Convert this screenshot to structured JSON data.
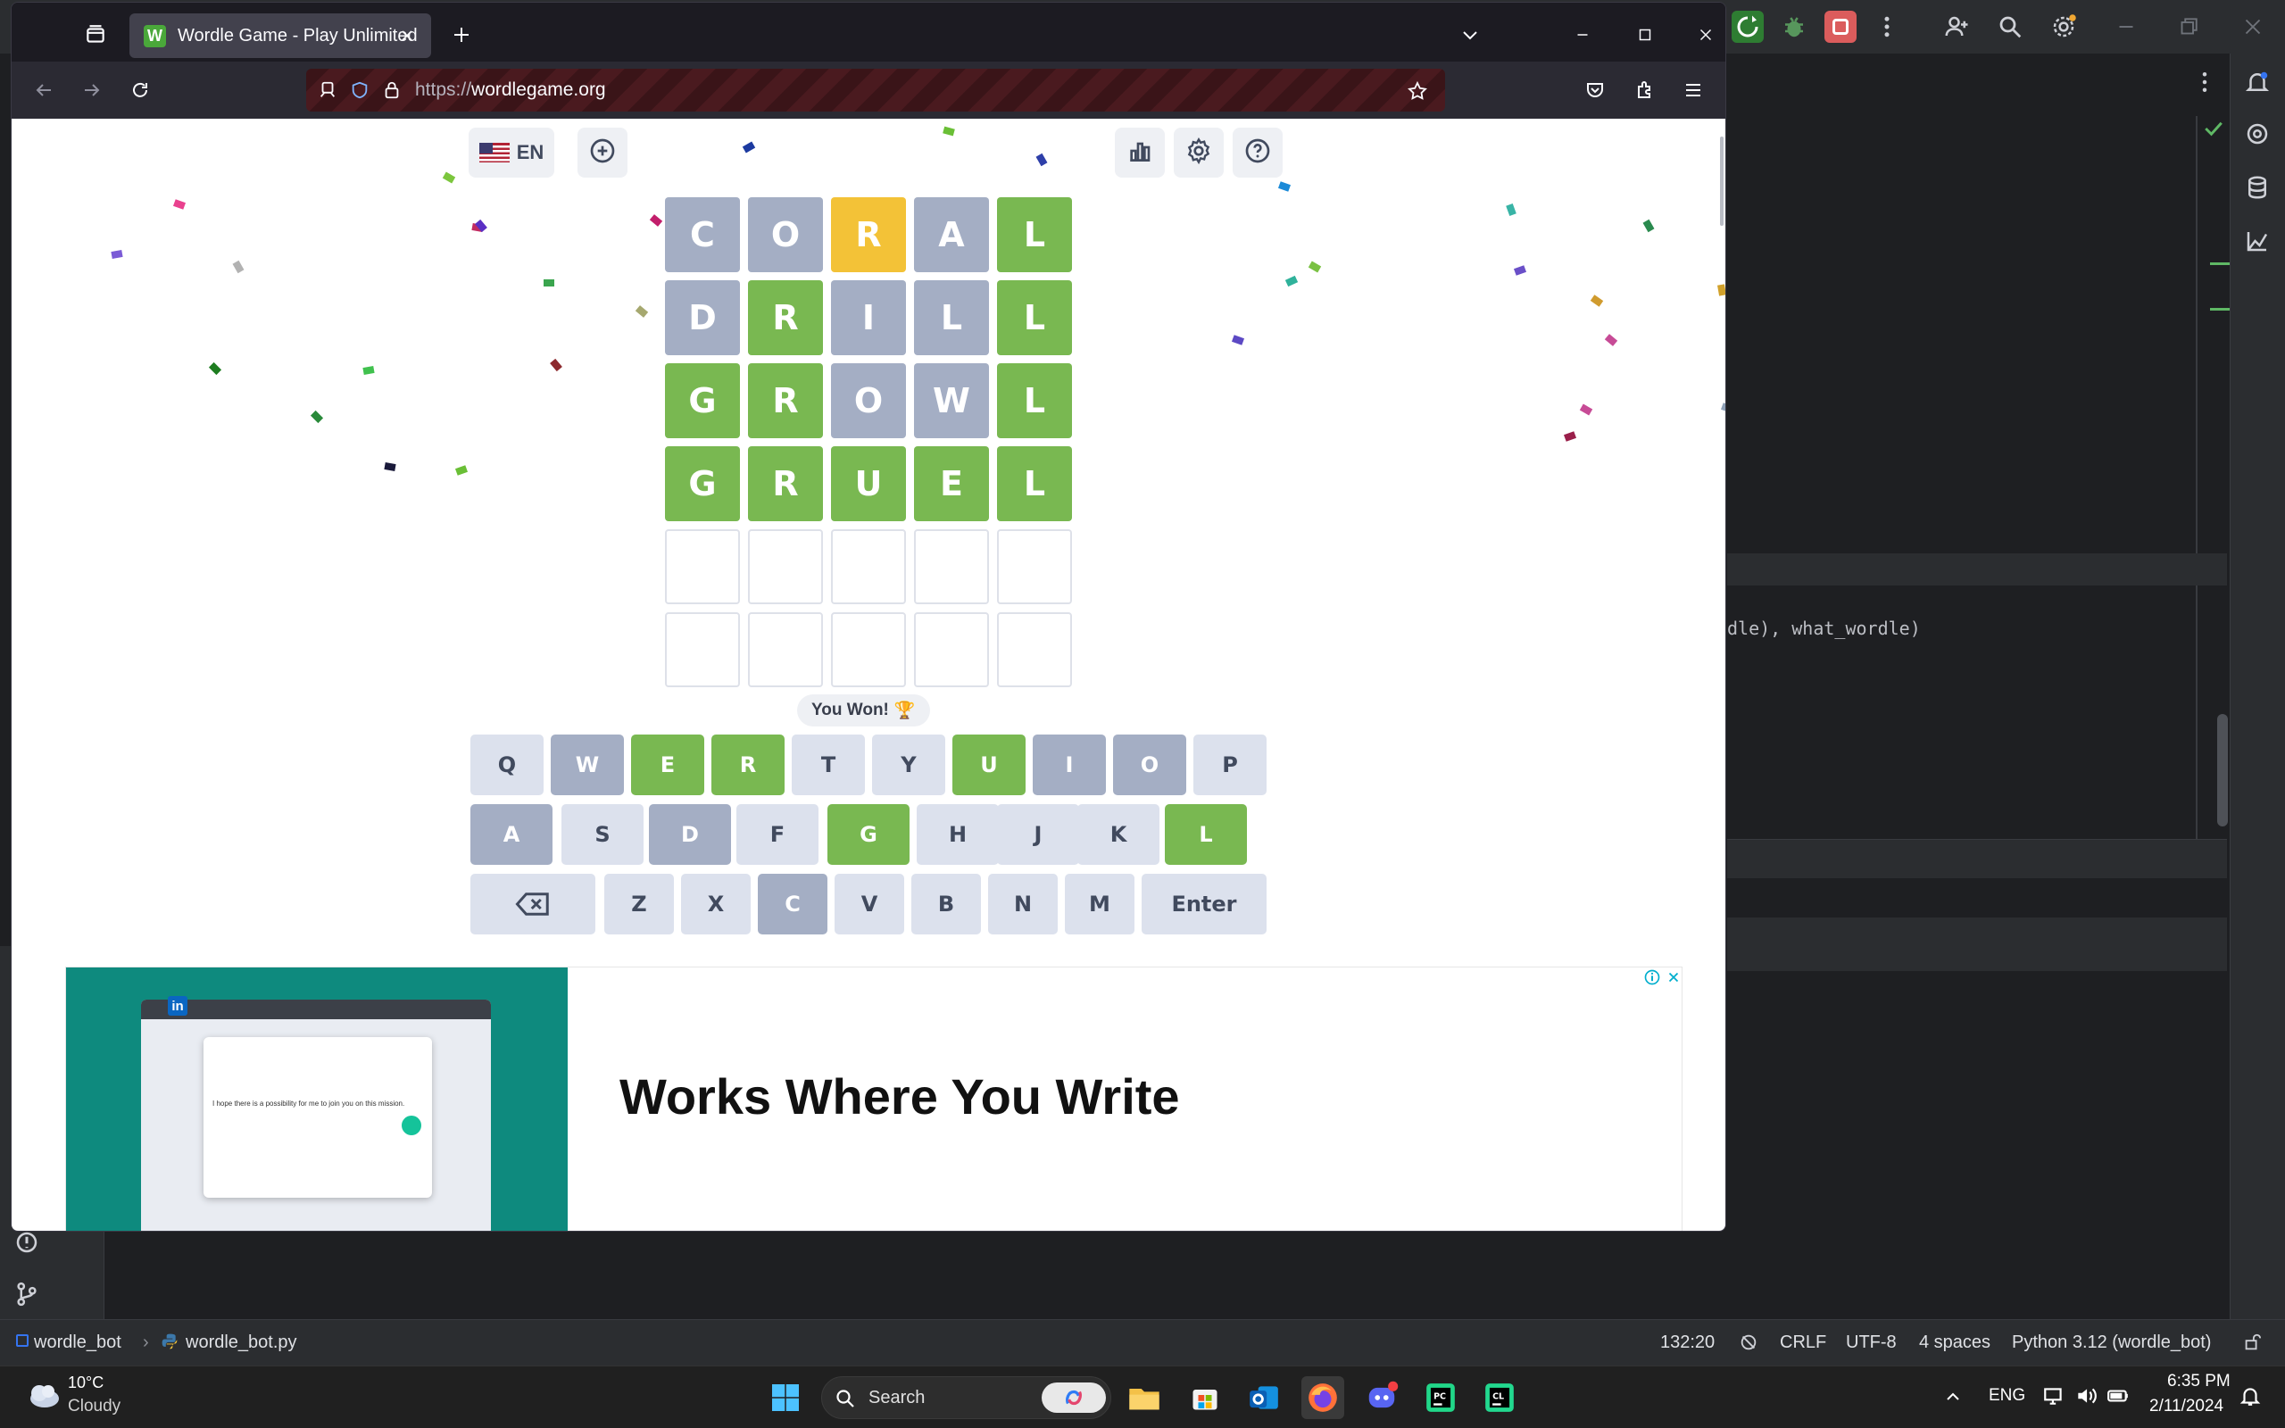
{
  "browser": {
    "tab_title": "Wordle Game - Play Unlimited",
    "tab_favicon_letter": "W",
    "url_scheme": "https://",
    "url_host": "wordlegame.org"
  },
  "wordle": {
    "language": "EN",
    "board": [
      [
        {
          "letter": "C",
          "state": "absent"
        },
        {
          "letter": "O",
          "state": "absent"
        },
        {
          "letter": "R",
          "state": "present"
        },
        {
          "letter": "A",
          "state": "absent"
        },
        {
          "letter": "L",
          "state": "correct"
        }
      ],
      [
        {
          "letter": "D",
          "state": "absent"
        },
        {
          "letter": "R",
          "state": "correct"
        },
        {
          "letter": "I",
          "state": "absent"
        },
        {
          "letter": "L",
          "state": "absent"
        },
        {
          "letter": "L",
          "state": "correct"
        }
      ],
      [
        {
          "letter": "G",
          "state": "correct"
        },
        {
          "letter": "R",
          "state": "correct"
        },
        {
          "letter": "O",
          "state": "absent"
        },
        {
          "letter": "W",
          "state": "absent"
        },
        {
          "letter": "L",
          "state": "correct"
        }
      ],
      [
        {
          "letter": "G",
          "state": "correct"
        },
        {
          "letter": "R",
          "state": "correct"
        },
        {
          "letter": "U",
          "state": "correct"
        },
        {
          "letter": "E",
          "state": "correct"
        },
        {
          "letter": "L",
          "state": "correct"
        }
      ],
      [
        {
          "letter": "",
          "state": "empty"
        },
        {
          "letter": "",
          "state": "empty"
        },
        {
          "letter": "",
          "state": "empty"
        },
        {
          "letter": "",
          "state": "empty"
        },
        {
          "letter": "",
          "state": "empty"
        }
      ],
      [
        {
          "letter": "",
          "state": "empty"
        },
        {
          "letter": "",
          "state": "empty"
        },
        {
          "letter": "",
          "state": "empty"
        },
        {
          "letter": "",
          "state": "empty"
        },
        {
          "letter": "",
          "state": "empty"
        }
      ]
    ],
    "toast_text": "You Won!",
    "toast_emoji": "🏆",
    "keyboard": [
      [
        {
          "key": "Q",
          "state": "unused"
        },
        {
          "key": "W",
          "state": "absent"
        },
        {
          "key": "E",
          "state": "correct"
        },
        {
          "key": "R",
          "state": "correct"
        },
        {
          "key": "T",
          "state": "unused"
        },
        {
          "key": "Y",
          "state": "unused"
        },
        {
          "key": "U",
          "state": "correct"
        },
        {
          "key": "I",
          "state": "absent"
        },
        {
          "key": "O",
          "state": "absent"
        },
        {
          "key": "P",
          "state": "unused"
        }
      ],
      [
        {
          "key": "A",
          "state": "absent"
        },
        {
          "key": "S",
          "state": "unused"
        },
        {
          "key": "D",
          "state": "absent"
        },
        {
          "key": "F",
          "state": "unused"
        },
        {
          "key": "G",
          "state": "correct"
        },
        {
          "key": "H",
          "state": "unused"
        },
        {
          "key": "J",
          "state": "unused"
        },
        {
          "key": "K",
          "state": "unused"
        },
        {
          "key": "L",
          "state": "correct"
        }
      ],
      [
        {
          "key": "backspace",
          "state": "unused"
        },
        {
          "key": "Z",
          "state": "unused"
        },
        {
          "key": "X",
          "state": "unused"
        },
        {
          "key": "C",
          "state": "absent"
        },
        {
          "key": "V",
          "state": "unused"
        },
        {
          "key": "B",
          "state": "unused"
        },
        {
          "key": "N",
          "state": "unused"
        },
        {
          "key": "M",
          "state": "unused"
        },
        {
          "key": "Enter",
          "state": "unused"
        }
      ]
    ]
  },
  "ad": {
    "headline": "Works Where You Write",
    "mock_linkedin": "in",
    "mock_text": "I hope there is a possibility for me to join you on this mission."
  },
  "ide": {
    "code_fragment": "dle), what_wordle)",
    "breadcrumb_project": "wordle_bot",
    "breadcrumb_file": "wordle_bot.py",
    "cursor_position": "132:20",
    "line_ending": "CRLF",
    "encoding": "UTF-8",
    "indent": "4 spaces",
    "interpreter": "Python 3.12 (wordle_bot)"
  },
  "taskbar": {
    "weather_temp": "10°C",
    "weather_desc": "Cloudy",
    "search_placeholder": "Search",
    "language": "ENG",
    "time": "6:35 PM",
    "date": "2/11/2024"
  },
  "colors": {
    "tile_correct": "#79b851",
    "tile_present": "#f3c237",
    "tile_absent": "#a4aec4",
    "key_unused": "#dce1ed",
    "ad_accent": "#0e8a7e"
  }
}
